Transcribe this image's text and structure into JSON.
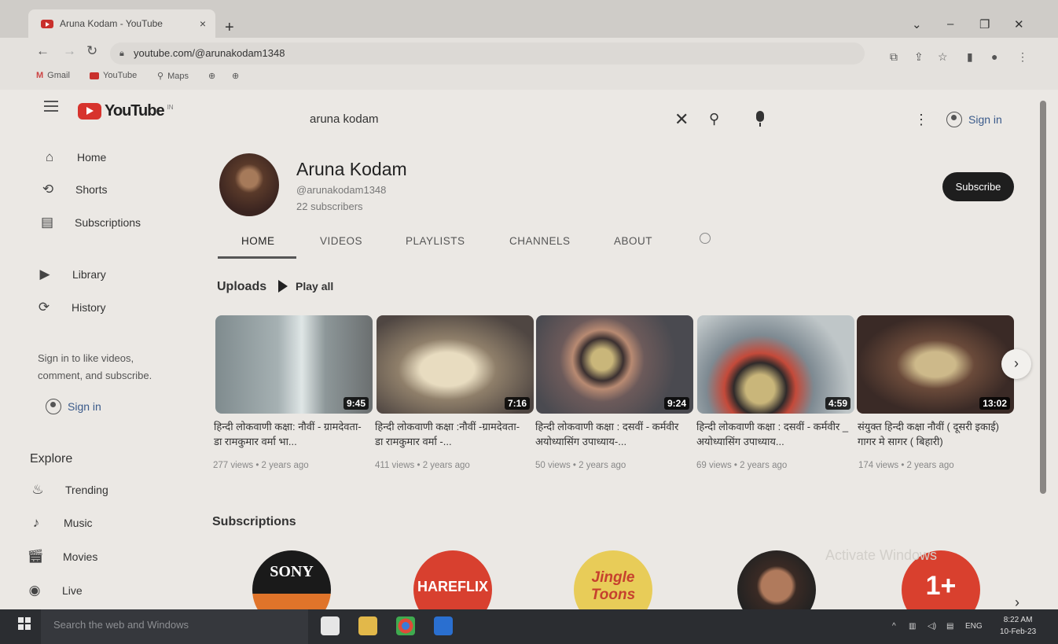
{
  "browser": {
    "tab_title": "Aruna Kodam - YouTube",
    "tab_close": "×",
    "new_tab": "+",
    "url": "youtube.com/@arunakodam1348",
    "bookmarks": [
      "Gmail",
      "YouTube",
      "Maps"
    ]
  },
  "youtube": {
    "logo_text": "YouTube",
    "logo_region": "IN",
    "search_value": "aruna kodam",
    "signin_label": "Sign in"
  },
  "sidebar": {
    "items": [
      {
        "label": "Home",
        "icon": "home-icon"
      },
      {
        "label": "Shorts",
        "icon": "shorts-icon"
      },
      {
        "label": "Subscriptions",
        "icon": "subscriptions-icon"
      },
      {
        "label": "Library",
        "icon": "library-icon"
      },
      {
        "label": "History",
        "icon": "history-icon"
      }
    ],
    "signin_note": "Sign in to like videos, comment, and subscribe.",
    "signin_label": "Sign in",
    "explore_heading": "Explore",
    "explore_items": [
      {
        "label": "Trending",
        "icon": "trending-icon"
      },
      {
        "label": "Music",
        "icon": "music-icon"
      },
      {
        "label": "Movies",
        "icon": "movies-icon"
      },
      {
        "label": "Live",
        "icon": "live-icon"
      }
    ]
  },
  "channel": {
    "name": "Aruna Kodam",
    "handle": "@arunakodam1348",
    "subscribers": "22 subscribers",
    "subscribe_label": "Subscribe",
    "tabs": [
      "HOME",
      "VIDEOS",
      "PLAYLISTS",
      "CHANNELS",
      "ABOUT"
    ],
    "active_tab": "HOME"
  },
  "uploads": {
    "heading": "Uploads",
    "play_all": "Play all",
    "videos": [
      {
        "title": "हिन्दी लोकवाणी कक्षा: नौवीं - ग्रामदेवता- डा रामकुमार वर्मा भा...",
        "duration": "9:45",
        "meta": "277 views • 2 years ago"
      },
      {
        "title": "हिन्दी लोकवाणी कक्षा :नौवीं -ग्रामदेवता- डा रामकुमार वर्मा -...",
        "duration": "7:16",
        "meta": "411 views • 2 years ago"
      },
      {
        "title": "हिन्दी लोकवाणी कक्षा : दसवीं - कर्मवीर अयोध्यासिंग उपाध्याय-...",
        "duration": "9:24",
        "meta": "50 views • 2 years ago"
      },
      {
        "title": "हिन्दी लोकवाणी कक्षा : दसवीं - कर्मवीर _ अयोध्यासिंग उपाध्याय...",
        "duration": "4:59",
        "meta": "69 views • 2 years ago"
      },
      {
        "title": "संयुक्त हिन्दी कक्षा नौवीं ( दूसरी इकाई) गागर मे सागर ( बिहारी)",
        "duration": "13:02",
        "meta": "174 views • 2 years ago"
      }
    ]
  },
  "subscriptions": {
    "heading": "Subscriptions",
    "channels": [
      "SONY",
      "HAREFLIX",
      "Jingle Toons",
      "",
      "1+"
    ]
  },
  "watermark": "Activate Windows",
  "taskbar": {
    "search_placeholder": "Search the web and Windows",
    "lang": "ENG",
    "time": "8:22 AM",
    "date": "10-Feb-23"
  }
}
